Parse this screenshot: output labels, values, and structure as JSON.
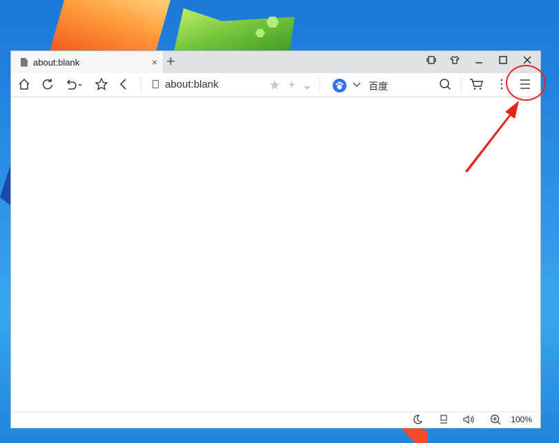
{
  "desktop": {
    "wallpaper": "windows-7-default"
  },
  "browser": {
    "tab": {
      "title": "about:blank",
      "icon": "page-icon",
      "close": "×"
    },
    "new_tab": "+",
    "window_controls": [
      "mirror-icon",
      "skin-icon",
      "minimize-icon",
      "maximize-icon",
      "close-icon"
    ],
    "toolbar": {
      "buttons": [
        "home-icon",
        "refresh-icon",
        "undo-icon",
        "favorite-icon",
        "back-icon"
      ],
      "address": "about:blank",
      "search_engine_label": "百度",
      "search_engine_color": "#3370ff"
    },
    "status": {
      "zoom": "100%"
    }
  },
  "annotation": {
    "highlight_color": "#e8231c",
    "target": "menu-icon"
  }
}
